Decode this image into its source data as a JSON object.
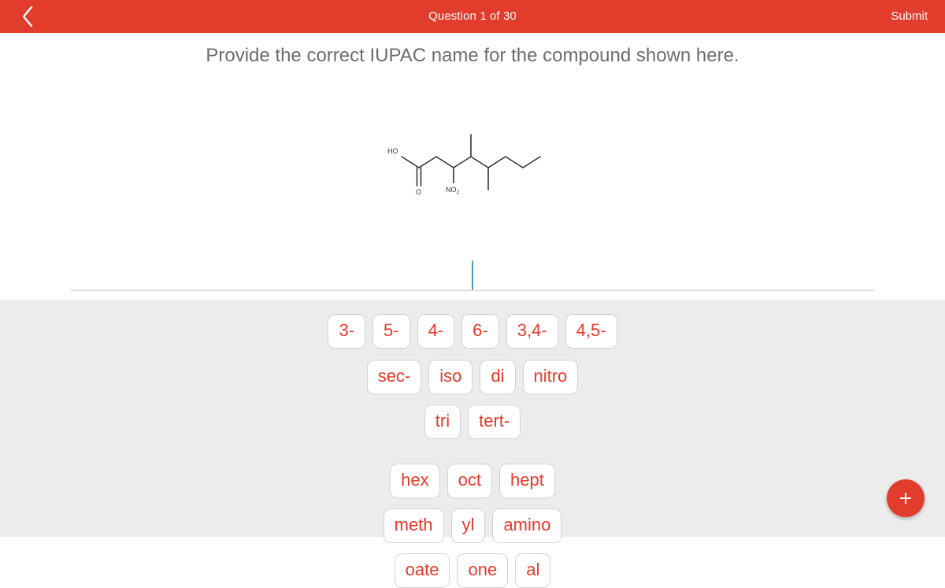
{
  "appbar": {
    "back_icon": "chevron-left-icon",
    "title": "Question 1 of 30",
    "submit_label": "Submit",
    "background_color": "#e23c2c",
    "text_color": "#ffffff"
  },
  "question": {
    "prompt": "Provide the correct IUPAC name for the compound shown here."
  },
  "molecule": {
    "label_hydroxyl": "HO",
    "label_carbonyl_oxygen": "O",
    "label_nitro": "NO",
    "label_nitro_subscript": "2",
    "bond_color": "#333333"
  },
  "answer_field": {
    "value": "",
    "caret_color": "#5b8fc7",
    "rule_color": "#dcdcdc"
  },
  "tray": {
    "background_color": "#ececec",
    "tile_text_color": "#e8392a",
    "rows": [
      {
        "tiles": [
          "3-",
          "5-",
          "4-",
          "6-",
          "3,4-",
          "4,5-"
        ]
      },
      {
        "tiles": [
          "sec-",
          "iso",
          "di",
          "nitro"
        ]
      },
      {
        "tiles": [
          "tri",
          "tert-"
        ]
      },
      {
        "tiles": [
          "hex",
          "oct",
          "hept"
        ]
      },
      {
        "tiles": [
          "meth",
          "yl",
          "amino"
        ]
      },
      {
        "tiles": [
          "oate",
          "one",
          "al"
        ]
      }
    ]
  },
  "fab": {
    "icon": "plus-icon",
    "color": "#e23c2c"
  }
}
